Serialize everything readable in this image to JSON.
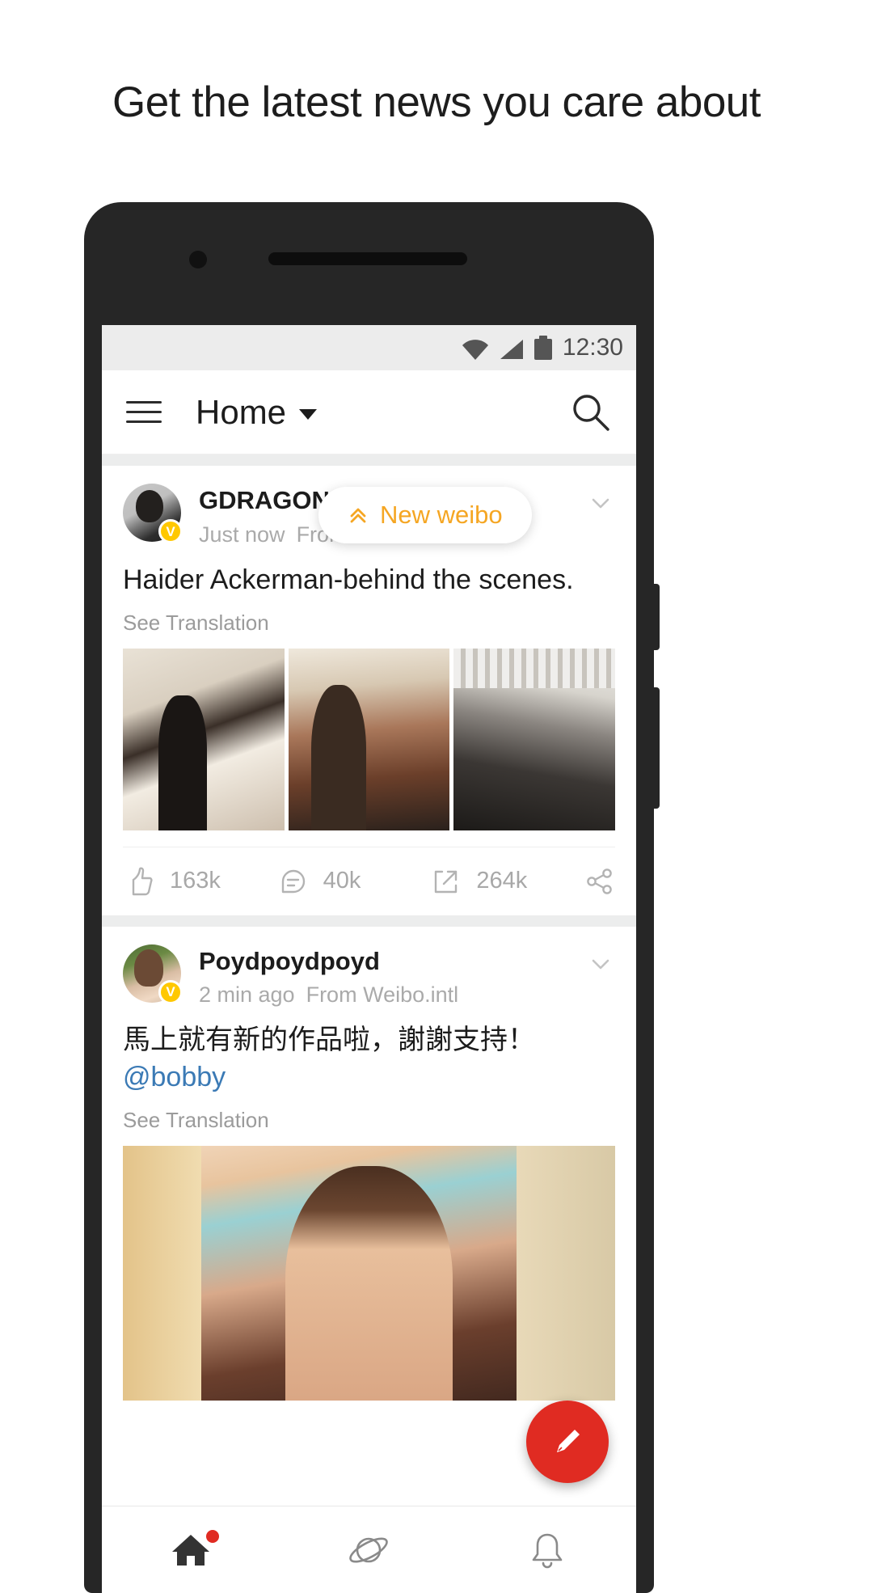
{
  "headline": "Get the latest news you care about",
  "statusbar": {
    "time": "12:30",
    "icons": [
      "wifi-icon",
      "cellular-signal-icon",
      "battery-icon"
    ]
  },
  "appbar": {
    "menu_icon": "hamburger-menu-icon",
    "title": "Home",
    "dropdown_icon": "chevron-down-icon",
    "search_icon": "search-icon"
  },
  "new_weibo_pill": {
    "label": "New weibo",
    "icon": "double-chevron-up-icon",
    "color": "#f5a623"
  },
  "posts": [
    {
      "user": "GDRAGON",
      "verified_badge": "V",
      "time": "Just now",
      "source": "From Weibo.intl",
      "text": "Haider Ackerman-behind the scenes.",
      "translate_label": "See Translation",
      "media_type": "image-grid",
      "media_count": 3,
      "actions": {
        "like_icon": "thumbs-up-icon",
        "like_count": "163k",
        "comment_icon": "comment-bubble-icon",
        "comment_count": "40k",
        "repost_icon": "repost-arrow-icon",
        "repost_count": "264k",
        "share_icon": "share-nodes-icon"
      },
      "more_icon": "chevron-down-icon"
    },
    {
      "user": "Poydpoydpoyd",
      "verified_badge": "V",
      "time": "2 min ago",
      "source": "From Weibo.intl",
      "text": "馬上就有新的作品啦，謝謝支持！",
      "mention": "@bobby",
      "translate_label": "See Translation",
      "media_type": "single-image",
      "media_count": 1,
      "more_icon": "chevron-down-icon"
    }
  ],
  "fab": {
    "icon": "compose-pencil-icon",
    "color": "#e02b22"
  },
  "bottomnav": {
    "items": [
      {
        "name": "home",
        "icon": "home-icon",
        "active": true,
        "badge": true
      },
      {
        "name": "discover",
        "icon": "planet-orbit-icon",
        "active": false,
        "badge": false
      },
      {
        "name": "notifications",
        "icon": "bell-icon",
        "active": false,
        "badge": false
      }
    ]
  }
}
